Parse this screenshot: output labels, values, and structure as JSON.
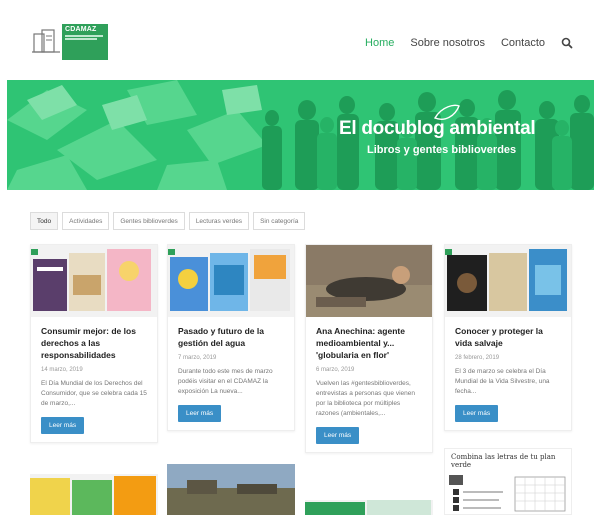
{
  "header": {
    "logo_title": "CDAMAZ",
    "nav": [
      {
        "label": "Home",
        "active": true
      },
      {
        "label": "Sobre nosotros",
        "active": false
      },
      {
        "label": "Contacto",
        "active": false
      }
    ]
  },
  "hero": {
    "title": "El docublog ambiental",
    "subtitle": "Libros y gentes biblioverdes"
  },
  "filters": [
    "Todo",
    "Actividades",
    "Gentes biblioverdes",
    "Lecturas verdes",
    "Sin categoría"
  ],
  "cards": [
    {
      "title": "Consumir mejor: de los derechos a las responsabilidades",
      "date": "14 marzo, 2019",
      "excerpt": "El Día Mundial de los Derechos del Consumidor, que se celebra cada 15 de marzo,...",
      "button": "Leer más"
    },
    {
      "title": "Pasado y futuro de la gestión del agua",
      "date": "7 marzo, 2019",
      "excerpt": "Durante todo este mes de marzo podéis visitar en el CDAMAZ la exposición La nueva...",
      "button": "Leer más"
    },
    {
      "title": "Ana Anechina: agente medioambiental y... 'globularia en flor'",
      "date": "6 marzo, 2019",
      "excerpt": "Vuelven las #gentesbiblioverdes, entrevistas a personas que vienen por la biblioteca por múltiples razones (ambientales,...",
      "button": "Leer más"
    },
    {
      "title": "Conocer y proteger la vida salvaje",
      "date": "28 febrero, 2019",
      "excerpt": "El 3 de marzo se celebra el Día Mundial de la Vida Silvestre, una fecha...",
      "button": "Leer más"
    }
  ],
  "row2_card4_text": "Combina las letras de tu plan verde"
}
